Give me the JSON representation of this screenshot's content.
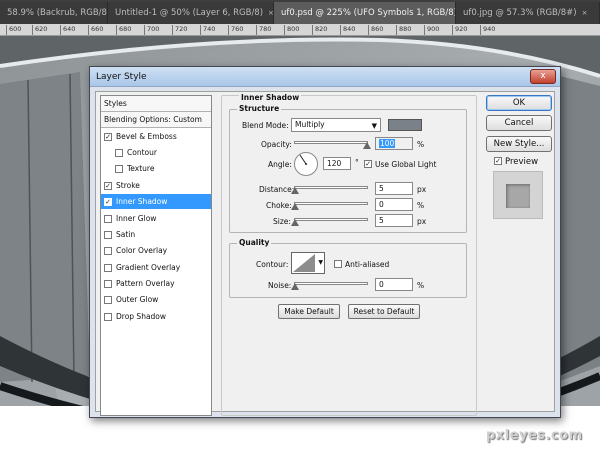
{
  "tabs": [
    {
      "label": "58.9% (Backrub, RGB/8)",
      "close": "×"
    },
    {
      "label": "Untitled-1 @ 50% (Layer 6, RGB/8)",
      "close": "×"
    },
    {
      "label": "uf0.psd @ 225% (UFO Symbols 1, RGB/8)",
      "close": "×"
    },
    {
      "label": "uf0.jpg @ 57.3% (RGB/8#)",
      "close": "×"
    }
  ],
  "ruler": [
    "600",
    "620",
    "640",
    "660",
    "680",
    "700",
    "720",
    "740",
    "760",
    "780",
    "800",
    "820",
    "840",
    "860",
    "880",
    "900",
    "920",
    "940"
  ],
  "dialog": {
    "title": "Layer Style",
    "close": "x",
    "styles_header": "Styles",
    "blending": "Blending Options: Custom",
    "items": [
      {
        "label": "Bevel & Emboss",
        "checked": "✓"
      },
      {
        "label": "Contour",
        "checked": ""
      },
      {
        "label": "Texture",
        "checked": ""
      },
      {
        "label": "Stroke",
        "checked": "✓"
      },
      {
        "label": "Inner Shadow",
        "checked": "✓"
      },
      {
        "label": "Inner Glow",
        "checked": ""
      },
      {
        "label": "Satin",
        "checked": ""
      },
      {
        "label": "Color Overlay",
        "checked": ""
      },
      {
        "label": "Gradient Overlay",
        "checked": ""
      },
      {
        "label": "Pattern Overlay",
        "checked": ""
      },
      {
        "label": "Outer Glow",
        "checked": ""
      },
      {
        "label": "Drop Shadow",
        "checked": ""
      }
    ],
    "panel": {
      "title": "Inner Shadow",
      "structure": "Structure",
      "blend_mode_label": "Blend Mode:",
      "blend_mode": "Multiply",
      "opacity_label": "Opacity:",
      "opacity": "100",
      "angle_label": "Angle:",
      "angle": "120",
      "degree": "°",
      "global_light": "Use Global Light",
      "global_light_checked": "✓",
      "distance_label": "Distance:",
      "distance": "5",
      "choke_label": "Choke:",
      "choke": "0",
      "size_label": "Size:",
      "size": "5",
      "unit_px": "px",
      "unit_pct": "%",
      "quality": "Quality",
      "contour_label": "Contour:",
      "anti_aliased": "Anti-aliased",
      "noise_label": "Noise:",
      "noise": "0",
      "make_default": "Make Default",
      "reset_default": "Reset to Default"
    },
    "buttons": {
      "ok": "OK",
      "cancel": "Cancel",
      "new_style": "New Style...",
      "preview": "Preview",
      "preview_checked": "✓"
    },
    "levels": {
      "opacity": 1.0,
      "distance": 0.0,
      "choke": 0.0,
      "size": 0.0,
      "noise": 0.0
    }
  },
  "colors": {
    "shadow_swatch": "#7a8189",
    "selection": "#3399ff"
  },
  "watermark": "pxleyes.com"
}
